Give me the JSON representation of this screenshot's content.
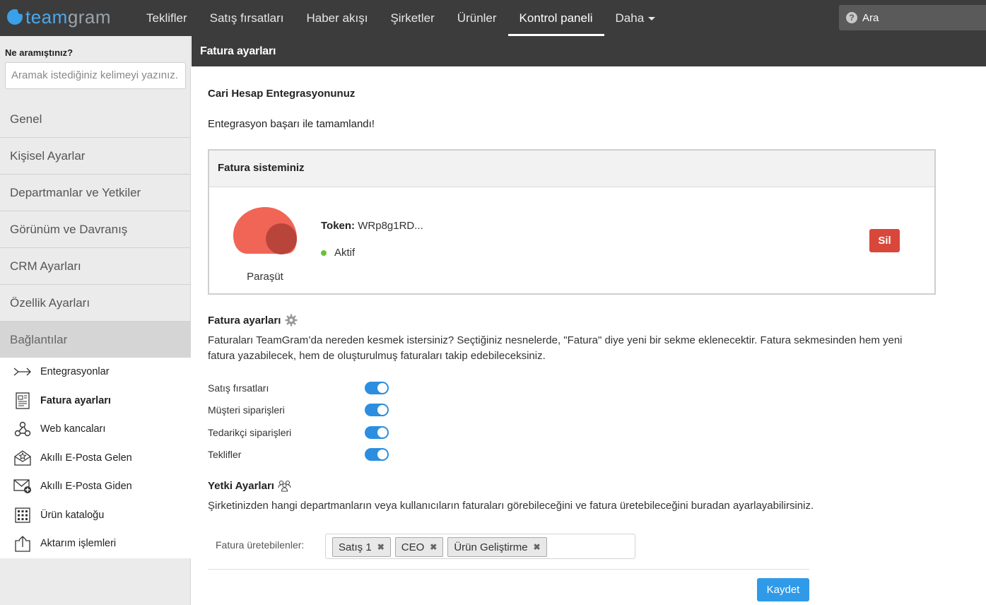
{
  "brand": {
    "logo_icon": "teamgram-fish-icon",
    "name_part1": "team",
    "name_part2": "gram",
    "accent": "#4aa8ee"
  },
  "nav": {
    "items": [
      "Teklifler",
      "Satış fırsatları",
      "Haber akışı",
      "Şirketler",
      "Ürünler",
      "Kontrol paneli"
    ],
    "active": "Kontrol paneli",
    "more_label": "Daha",
    "search_placeholder": "Ara"
  },
  "sidebar": {
    "search_label": "Ne aramıştınız?",
    "search_placeholder": "Aramak istediğiniz kelimeyi yazınız.",
    "sections": [
      "Genel",
      "Kişisel Ayarlar",
      "Departmanlar ve Yetkiler",
      "Görünüm ve Davranış",
      "CRM Ayarları",
      "Özellik Ayarları",
      "Bağlantılar"
    ],
    "active_section": "Bağlantılar",
    "subitems": [
      {
        "label": "Entegrasyonlar",
        "icon": "integration-arrow-icon"
      },
      {
        "label": "Fatura ayarları",
        "icon": "invoice-document-icon"
      },
      {
        "label": "Web kancaları",
        "icon": "webhook-icon"
      },
      {
        "label": "Akıllı E-Posta Gelen",
        "icon": "mail-inbox-star-icon"
      },
      {
        "label": "Akıllı E-Posta Giden",
        "icon": "mail-outgoing-icon"
      },
      {
        "label": "Ürün kataloğu",
        "icon": "grid-catalog-icon"
      },
      {
        "label": "Aktarım işlemleri",
        "icon": "upload-transfer-icon"
      }
    ],
    "active_subitem": "Fatura ayarları"
  },
  "main": {
    "header_title": "Fatura ayarları",
    "integration_heading": "Cari Hesap Entegrasyonunuz",
    "integration_success": "Entegrasyon başarı ile tamamlandı!",
    "invoice_system": {
      "heading": "Fatura sisteminiz",
      "provider_name": "Paraşüt",
      "token_label": "Token:",
      "token_value": "WRp8g1RD...",
      "status": "Aktif",
      "status_color": "#6cbf3b",
      "delete_label": "Sil",
      "delete_color": "#d9473b"
    },
    "invoice_settings": {
      "heading": "Fatura ayarları",
      "heading_icon": "gear-icon",
      "description": "Faturaları TeamGram’da nereden kesmek istersiniz? Seçtiğiniz nesnelerde, \"Fatura\" diye yeni bir sekme eklenecektir. Fatura sekmesinden hem yeni fatura yazabilecek, hem de oluşturulmuş faturaları takip edebileceksiniz.",
      "toggles": [
        {
          "label": "Satış fırsatları",
          "on": true
        },
        {
          "label": "Müşteri siparişleri",
          "on": true
        },
        {
          "label": "Tedarikçi siparişleri",
          "on": true
        },
        {
          "label": "Teklifler",
          "on": true
        }
      ]
    },
    "permissions": {
      "heading": "Yetki Ayarları",
      "heading_icon": "users-group-icon",
      "description": "Şirketinizden hangi departmanların veya kullanıcıların faturaları görebileceğini ve fatura üretebileceğini buradan ayarlayabilirsiniz.",
      "field_label": "Fatura üretebilenler:",
      "tags": [
        "Satış 1",
        "CEO",
        "Ürün Geliştirme"
      ],
      "tag_remove_glyph": "✖"
    },
    "save_label": "Kaydet",
    "save_color": "#2f9ae8"
  }
}
